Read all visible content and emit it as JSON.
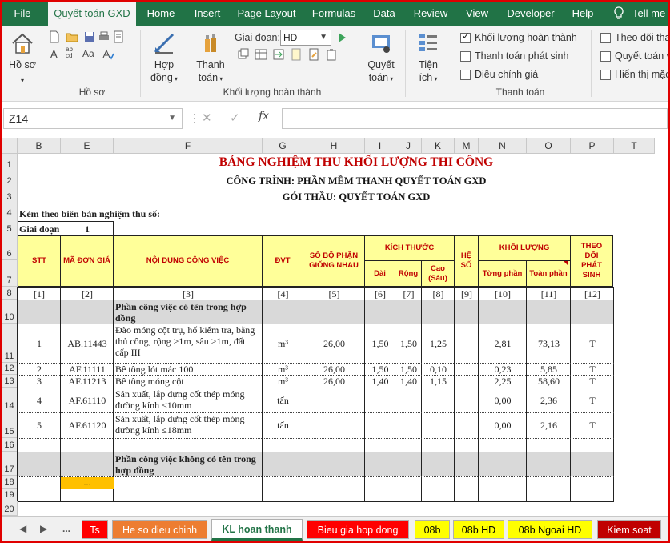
{
  "ribbon": {
    "tabs": [
      "File",
      "Quyết toán GXD",
      "Home",
      "Insert",
      "Page Layout",
      "Formulas",
      "Data",
      "Review",
      "View",
      "Developer",
      "Help",
      "Tell me"
    ],
    "active_tab": "Quyết toán GXD",
    "groups": {
      "ho_so": {
        "label": "Hồ sơ",
        "button": "Hồ sơ"
      },
      "khoi_luong": {
        "label": "Khối lượng hoàn thành",
        "hop_dong": "Hợp đồng",
        "thanh_toan": "Thanh toán",
        "stage_label": "Giai đoạn:",
        "stage_value": "HD"
      },
      "quyet_toan": {
        "button": "Quyết toán"
      },
      "tien_ich": {
        "button": "Tiện ích"
      },
      "thanh_toan": {
        "label": "Thanh toán",
        "checkboxes": [
          {
            "label": "Khối lượng hoàn thành",
            "checked": true
          },
          {
            "label": "Thanh toán phát sinh",
            "checked": false
          },
          {
            "label": "Điều chỉnh giá",
            "checked": false
          }
        ]
      },
      "extra": {
        "checkboxes": [
          {
            "label": "Theo dõi thanh",
            "checked": false
          },
          {
            "label": "Quyết toán vo",
            "checked": false
          },
          {
            "label": "Hiển thị mặc",
            "checked": false
          }
        ]
      }
    }
  },
  "formula_bar": {
    "name_box": "Z14",
    "cancel": "✕",
    "enter": "✓",
    "fx": "fx",
    "formula": ""
  },
  "columns": [
    "B",
    "E",
    "F",
    "G",
    "H",
    "I",
    "J",
    "K",
    "M",
    "N",
    "O",
    "P",
    "T"
  ],
  "rows": [
    "1",
    "2",
    "3",
    "4",
    "5",
    "6",
    "7",
    "8",
    "10",
    "11",
    "12",
    "13",
    "14",
    "15",
    "16",
    "17",
    "18",
    "19",
    "20"
  ],
  "sheet": {
    "title": "BẢNG NGHIỆM THU KHỐI LƯỢNG THI CÔNG",
    "project": "CÔNG TRÌNH: PHẦN MỀM THANH QUYẾT TOÁN GXD",
    "package": "GÓI THẦU: QUYẾT TOÁN GXD",
    "attached": "Kèm theo biên bản nghiệm thu số:",
    "stage_label": "Giai đoạn",
    "stage_value": "1",
    "headers": {
      "stt": "STT",
      "ma": "MÃ ĐƠN GIÁ",
      "noidung": "NỘI DUNG CÔNG VIỆC",
      "dvt": "ĐVT",
      "sobo": "SỐ BỘ PHẬN GIỐNG NHAU",
      "kichthuoc": "KÍCH THƯỚC",
      "dai": "Dài",
      "rong": "Rộng",
      "cao": "Cao (Sâu)",
      "heso": "HỆ SỐ",
      "khoiluong": "KHỐI LƯỢNG",
      "tungphan": "Từng phần",
      "toanphan": "Toàn phần",
      "theodoi": "THEO DÕI PHÁT SINH"
    },
    "index_row": [
      "[1]",
      "[2]",
      "[3]",
      "[4]",
      "[5]",
      "[6]",
      "[7]",
      "[8]",
      "[9]",
      "[10]",
      "[11]",
      "[12]"
    ],
    "section1": "Phần công việc có tên trong hợp đồng",
    "items": [
      {
        "stt": "1",
        "ma": "AB.11443",
        "noidung": "Đào móng cột trụ, hố kiểm tra, bằng thủ công, rộng >1m, sâu >1m, đất cấp III",
        "dvt": "m³",
        "sobo": "26,00",
        "dai": "1,50",
        "rong": "1,50",
        "cao": "1,25",
        "tung": "2,81",
        "toan": "73,13",
        "theo": "T"
      },
      {
        "stt": "2",
        "ma": "AF.11111",
        "noidung": "Bê tông lót mác 100",
        "dvt": "m³",
        "sobo": "26,00",
        "dai": "1,50",
        "rong": "1,50",
        "cao": "0,10",
        "tung": "0,23",
        "toan": "5,85",
        "theo": "T"
      },
      {
        "stt": "3",
        "ma": "AF.11213",
        "noidung": "Bê tông móng cột",
        "dvt": "m³",
        "sobo": "26,00",
        "dai": "1,40",
        "rong": "1,40",
        "cao": "1,15",
        "tung": "2,25",
        "toan": "58,60",
        "theo": "T"
      },
      {
        "stt": "4",
        "ma": "AF.61110",
        "noidung": "Sản xuất, lắp dựng cốt thép móng đường kính ≤10mm",
        "dvt": "tấn",
        "sobo": "",
        "dai": "",
        "rong": "",
        "cao": "",
        "tung": "0,00",
        "toan": "2,36",
        "theo": "T"
      },
      {
        "stt": "5",
        "ma": "AF.61120",
        "noidung": "Sản xuất, lắp dựng cốt thép móng đường kính ≤18mm",
        "dvt": "tấn",
        "sobo": "",
        "dai": "",
        "rong": "",
        "cao": "",
        "tung": "0,00",
        "toan": "2,16",
        "theo": "T"
      }
    ],
    "section2": "Phần công việc không có tên trong hợp đồng",
    "ellipsis": "..."
  },
  "sheet_tabs": {
    "more": "...",
    "tabs": [
      {
        "label": "Ts",
        "bg": "#ff0000",
        "fg": "#ffffff"
      },
      {
        "label": "He so dieu chinh",
        "bg": "#ed7d31",
        "fg": "#ffffff"
      },
      {
        "label": "KL hoan thanh",
        "bg": "#ffffff",
        "fg": "#217346"
      },
      {
        "label": "Bieu gia hop dong",
        "bg": "#ff0000",
        "fg": "#ffffff"
      },
      {
        "label": "08b",
        "bg": "#ffff00",
        "fg": "#000000"
      },
      {
        "label": "08b HD",
        "bg": "#ffff00",
        "fg": "#000000"
      },
      {
        "label": "08b Ngoai HD",
        "bg": "#ffff00",
        "fg": "#000000"
      },
      {
        "label": "Kiem soat",
        "bg": "#c00000",
        "fg": "#ffffff"
      }
    ]
  },
  "colors": {
    "accent": "#217346",
    "header_fill": "#ffff99",
    "header_text": "#c00000",
    "title": "#c00000",
    "section_fill": "#d9d9d9",
    "highlight": "#ffc000"
  }
}
